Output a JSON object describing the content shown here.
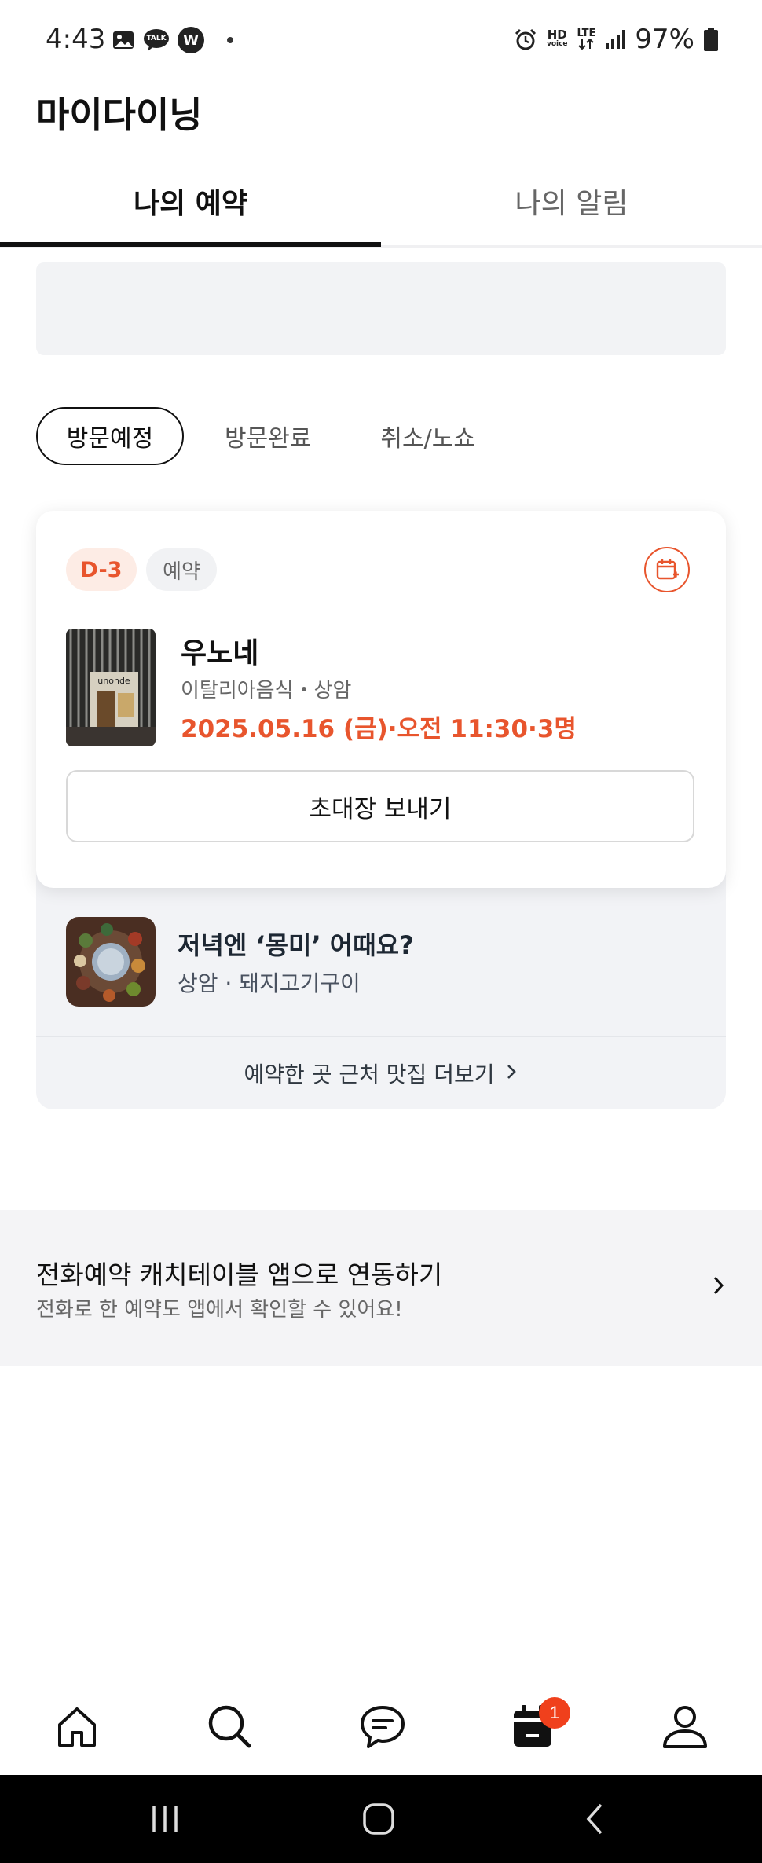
{
  "status_bar": {
    "time": "4:43",
    "left_icons": [
      "gallery-icon",
      "kakaotalk-icon",
      "w-app-icon",
      "dot-icon"
    ],
    "talk_label": "TALK",
    "w_label": "W",
    "hd_label": "HD",
    "voice_label": "voice",
    "lte_label": "LTE",
    "battery": "97%"
  },
  "header": {
    "title": "마이다이닝"
  },
  "tabs": [
    {
      "label": "나의 예약",
      "active": true
    },
    {
      "label": "나의 알림",
      "active": false
    }
  ],
  "filters": [
    {
      "label": "방문예정",
      "active": true
    },
    {
      "label": "방문완료",
      "active": false
    },
    {
      "label": "취소/노쇼",
      "active": false
    }
  ],
  "reservation": {
    "dday": "D-3",
    "type": "예약",
    "restaurant": "우노네",
    "thumb_sign": "unonde",
    "category": "이탈리아음식",
    "area": "상암",
    "datetime": "2025.05.16 (금)·오전 11:30·3명",
    "invite_button": "초대장 보내기",
    "accent": "#e8552d"
  },
  "recommendation": {
    "title": "저녁엔 ‘몽미’ 어때요?",
    "subtitle": "상암 · 돼지고기구이",
    "more_link": "예약한 곳 근처 맛집 더보기"
  },
  "phone_link": {
    "title": "전화예약 캐치테이블 앱으로 연동하기",
    "subtitle": "전화로 한 예약도 앱에서 확인할 수 있어요!"
  },
  "bottom_nav": {
    "items": [
      "home-icon",
      "search-icon",
      "chat-icon",
      "calendar-icon",
      "profile-icon"
    ],
    "badge_count": "1",
    "badge_color": "#f0401c"
  }
}
